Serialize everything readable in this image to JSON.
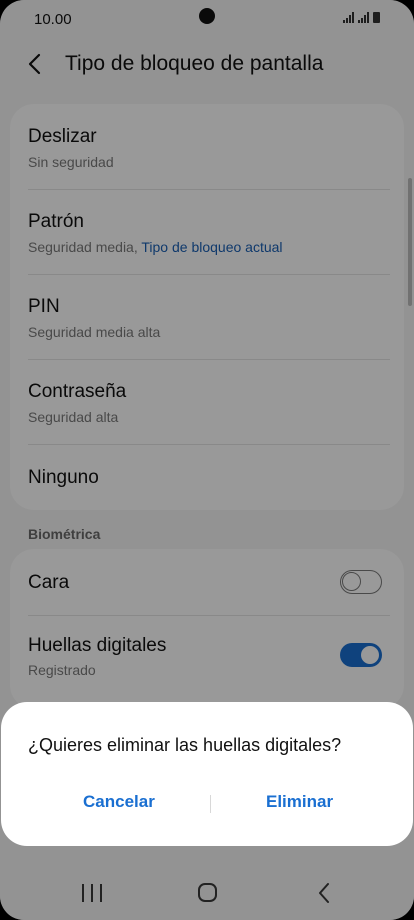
{
  "status_bar": {
    "time": "10.00"
  },
  "header": {
    "title": "Tipo de bloqueo de pantalla"
  },
  "lock_types": [
    {
      "title": "Deslizar",
      "subtitle": "Sin seguridad"
    },
    {
      "title": "Patrón",
      "subtitle": "Seguridad media, ",
      "subtitle_accent": "Tipo de bloqueo actual"
    },
    {
      "title": "PIN",
      "subtitle": "Seguridad media alta"
    },
    {
      "title": "Contraseña",
      "subtitle": "Seguridad alta"
    },
    {
      "title": "Ninguno"
    }
  ],
  "biometrics": {
    "section_label": "Biométrica",
    "items": [
      {
        "title": "Cara",
        "enabled": false
      },
      {
        "title": "Huellas digitales",
        "subtitle": "Registrado",
        "enabled": true
      }
    ]
  },
  "dialog": {
    "message": "¿Quieres eliminar las huellas digitales?",
    "cancel_label": "Cancelar",
    "delete_label": "Eliminar"
  },
  "colors": {
    "accent": "#1a6fd1",
    "link": "#1a5fb4"
  },
  "icons": {
    "back": "chevron-left-icon",
    "nav_recents": "recents-icon",
    "nav_home": "home-icon",
    "nav_back": "back-icon"
  }
}
